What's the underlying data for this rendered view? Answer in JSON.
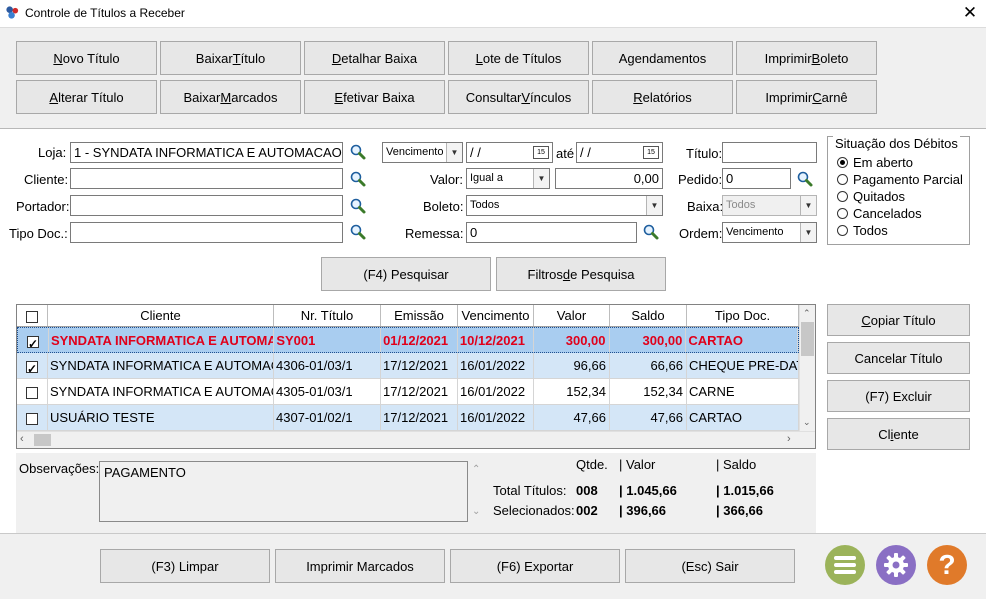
{
  "window": {
    "title": "Controle de Títulos a Receber",
    "close_glyph": "✕"
  },
  "toolbar": {
    "row1": [
      {
        "pre": "",
        "u": "N",
        "post": "ovo Título"
      },
      {
        "pre": "Baixar ",
        "u": "T",
        "post": "ítulo"
      },
      {
        "pre": "",
        "u": "D",
        "post": "etalhar Baixa"
      },
      {
        "pre": "",
        "u": "L",
        "post": "ote de Títulos"
      },
      {
        "pre": "Agendamentos",
        "u": "",
        "post": ""
      },
      {
        "pre": "Imprimir ",
        "u": "B",
        "post": "oleto"
      }
    ],
    "row2": [
      {
        "pre": "",
        "u": "A",
        "post": "lterar Título"
      },
      {
        "pre": "Baixar ",
        "u": "M",
        "post": "arcados"
      },
      {
        "pre": "",
        "u": "E",
        "post": "fetivar Baixa"
      },
      {
        "pre": "Consultar ",
        "u": "V",
        "post": "ínculos"
      },
      {
        "pre": "",
        "u": "R",
        "post": "elatórios"
      },
      {
        "pre": "Imprimir ",
        "u": "C",
        "post": "arnê"
      }
    ]
  },
  "filters": {
    "loja_label": "Loja:",
    "loja_value": "1 - SYNDATA INFORMATICA E AUTOMACAO",
    "cliente_label": "Cliente:",
    "cliente_value": "",
    "portador_label": "Portador:",
    "portador_value": "",
    "tipo_doc_label": "Tipo Doc.:",
    "tipo_doc_value": "",
    "data_tipo": "Vencimento",
    "data_de": " / /",
    "ate_label": "até",
    "data_ate": " / /",
    "cal_label": "15",
    "valor_label": "Valor:",
    "valor_op": "Igual a",
    "valor_value": "0,00",
    "boleto_label": "Boleto:",
    "boleto_value": "Todos",
    "remessa_label": "Remessa:",
    "remessa_value": "0",
    "titulo_label": "Título:",
    "titulo_value": "",
    "pedido_label": "Pedido:",
    "pedido_value": "0",
    "baixa_label": "Baixa:",
    "baixa_value": "Todos",
    "ordem_label": "Ordem:",
    "ordem_value": "Vencimento"
  },
  "situacao": {
    "legend": "Situação dos Débitos",
    "options": [
      "Em aberto",
      "Pagamento Parcial",
      "Quitados",
      "Cancelados",
      "Todos"
    ],
    "selected": "Em aberto"
  },
  "search": {
    "pesquisar": {
      "pre": "(F4) Pesquisar",
      "u": "",
      "post": ""
    },
    "filtros": {
      "pre": "Filtros ",
      "u": "d",
      "post": "e Pesquisa"
    }
  },
  "grid": {
    "columns": [
      "",
      "Cliente",
      "Nr. Título",
      "Emissão",
      "Vencimento",
      "Valor",
      "Saldo",
      "Tipo Doc."
    ],
    "rows": [
      {
        "checked": true,
        "cliente": "SYNDATA INFORMATICA E AUTOMACAO",
        "titulo": "SY001",
        "emissao": "01/12/2021",
        "vencimento": "10/12/2021",
        "valor": "300,00",
        "saldo": "300,00",
        "tipo": "CARTAO",
        "style": "selected"
      },
      {
        "checked": true,
        "cliente": "SYNDATA INFORMATICA E AUTOMACAO",
        "titulo": "4306-01/03/1",
        "emissao": "17/12/2021",
        "vencimento": "16/01/2022",
        "valor": "96,66",
        "saldo": "66,66",
        "tipo": "CHEQUE PRE-DATADO",
        "style": "alt"
      },
      {
        "checked": false,
        "cliente": "SYNDATA INFORMATICA E AUTOMACAO",
        "titulo": "4305-01/03/1",
        "emissao": "17/12/2021",
        "vencimento": "16/01/2022",
        "valor": "152,34",
        "saldo": "152,34",
        "tipo": "CARNE",
        "style": "plain"
      },
      {
        "checked": false,
        "cliente": "USUÁRIO TESTE",
        "titulo": "4307-01/02/1",
        "emissao": "17/12/2021",
        "vencimento": "16/01/2022",
        "valor": "47,66",
        "saldo": "47,66",
        "tipo": "CARTAO",
        "style": "alt"
      }
    ]
  },
  "side_buttons": [
    {
      "pre": "",
      "u": "C",
      "post": "opiar Título"
    },
    {
      "pre": "Cancelar Título",
      "u": "",
      "post": ""
    },
    {
      "pre": "(F7) Excluir",
      "u": "",
      "post": ""
    },
    {
      "pre": "Cl",
      "u": "i",
      "post": "ente"
    }
  ],
  "observacoes": {
    "label": "Observações:",
    "text": "PAGAMENTO"
  },
  "totals": {
    "qtde_header": "Qtde.",
    "valor_header": "| Valor",
    "saldo_header": "| Saldo",
    "total_label": "Total Títulos:",
    "total_qtde": "008",
    "total_valor": "| 1.045,66",
    "total_saldo": "| 1.015,66",
    "sel_label": "Selecionados:",
    "sel_qtde": "002",
    "sel_valor": "| 396,66",
    "sel_saldo": "| 366,66"
  },
  "footer": {
    "limpar": "(F3) Limpar",
    "imprimir": "Imprimir Marcados",
    "exportar": "(F6) Exportar",
    "sair": "(Esc) Sair"
  },
  "colors": {
    "menu_icon": "#9bb35a",
    "settings_icon": "#8a6fc4",
    "help_icon": "#e07a2a",
    "selected_row_text": "#e0001a",
    "selected_row_bg": "#a9cdf0",
    "alt_row_bg": "#d4e6f7"
  }
}
